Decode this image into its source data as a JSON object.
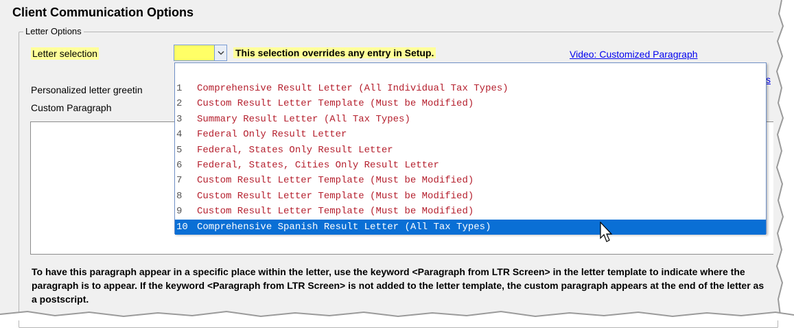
{
  "page": {
    "title": "Client Communication Options"
  },
  "letter_options": {
    "group_label": "Letter Options",
    "letter_selection_label": "Letter selection",
    "letter_selection_value": "",
    "override_note": "This selection overrides any entry in Setup.",
    "video_link": "Video: Customized Paragraph",
    "cut_link": "s",
    "greeting_label": "Personalized letter greetin",
    "custom_paragraph_label": "Custom Paragraph",
    "custom_paragraph_value": "",
    "footer_text": "To have this paragraph appear in a specific place within the letter, use the keyword <Paragraph from LTR Screen> in the letter template to indicate where the paragraph is to appear. If the keyword <Paragraph from LTR Screen> is not added to the letter template, the custom paragraph appears at the end of the letter as a postscript."
  },
  "dropdown": {
    "items": [
      {
        "num": "1",
        "label": "Comprehensive Result Letter (All Individual Tax Types)"
      },
      {
        "num": "2",
        "label": "Custom Result Letter Template (Must be Modified)"
      },
      {
        "num": "3",
        "label": "Summary Result Letter (All Tax Types)"
      },
      {
        "num": "4",
        "label": "Federal Only Result Letter"
      },
      {
        "num": "5",
        "label": "Federal, States Only Result Letter"
      },
      {
        "num": "6",
        "label": "Federal, States, Cities Only Result Letter"
      },
      {
        "num": "7",
        "label": "Custom Result Letter Template (Must be Modified)"
      },
      {
        "num": "8",
        "label": "Custom Result Letter Template (Must be Modified)"
      },
      {
        "num": "9",
        "label": "Custom Result Letter Template (Must be Modified)"
      },
      {
        "num": "10",
        "label": "Comprehensive Spanish Result Letter (All Tax Types)"
      }
    ],
    "selected_index": 9
  },
  "colors": {
    "item_text": "#b5202e",
    "selected_bg": "#0a6fd5",
    "highlight": "#ffff99",
    "link": "#0000ee"
  }
}
